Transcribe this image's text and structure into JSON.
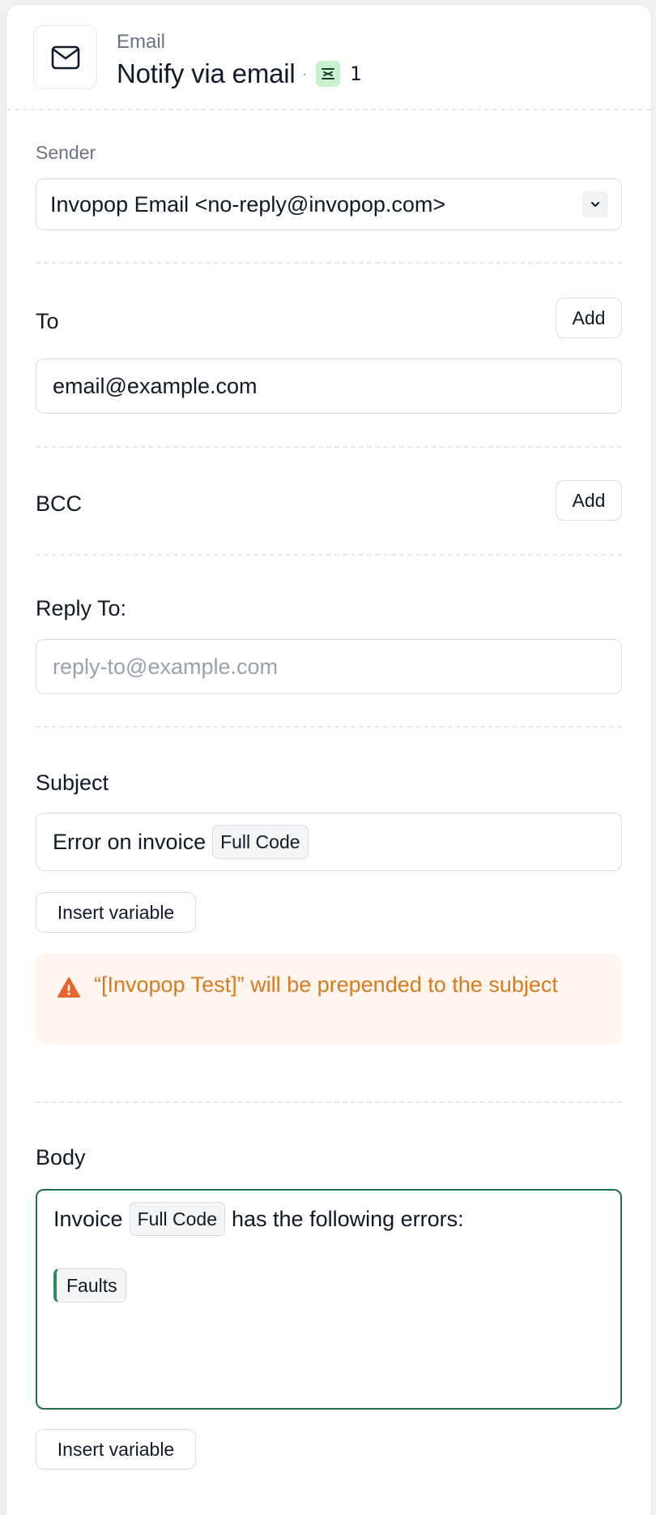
{
  "header": {
    "kicker": "Email",
    "title": "Notify via email",
    "separator": "·",
    "workflow_count": "1",
    "icons": {
      "action": "mail-icon",
      "workflow": "workflow-stack-icon"
    }
  },
  "sender": {
    "label": "Sender",
    "value": "Invopop Email <no-reply@invopop.com>"
  },
  "to": {
    "label": "To",
    "add_label": "Add",
    "value": "email@example.com"
  },
  "bcc": {
    "label": "BCC",
    "add_label": "Add"
  },
  "reply_to": {
    "label": "Reply To:",
    "placeholder": "reply-to@example.com"
  },
  "subject": {
    "label": "Subject",
    "text": "Error on invoice",
    "variable": "Full Code",
    "insert_label": "Insert variable",
    "warning": "“[Invopop Test]” will be prepended to the subject"
  },
  "body": {
    "label": "Body",
    "prefix": "Invoice",
    "variable": "Full Code",
    "suffix": "has the following errors:",
    "block_variable": "Faults",
    "insert_label": "Insert variable"
  },
  "colors": {
    "accent_green": "#1f6f4a",
    "warning_text": "#d97a1f",
    "warning_bg": "#fff6ef",
    "badge_green": "#c9f0cf"
  }
}
